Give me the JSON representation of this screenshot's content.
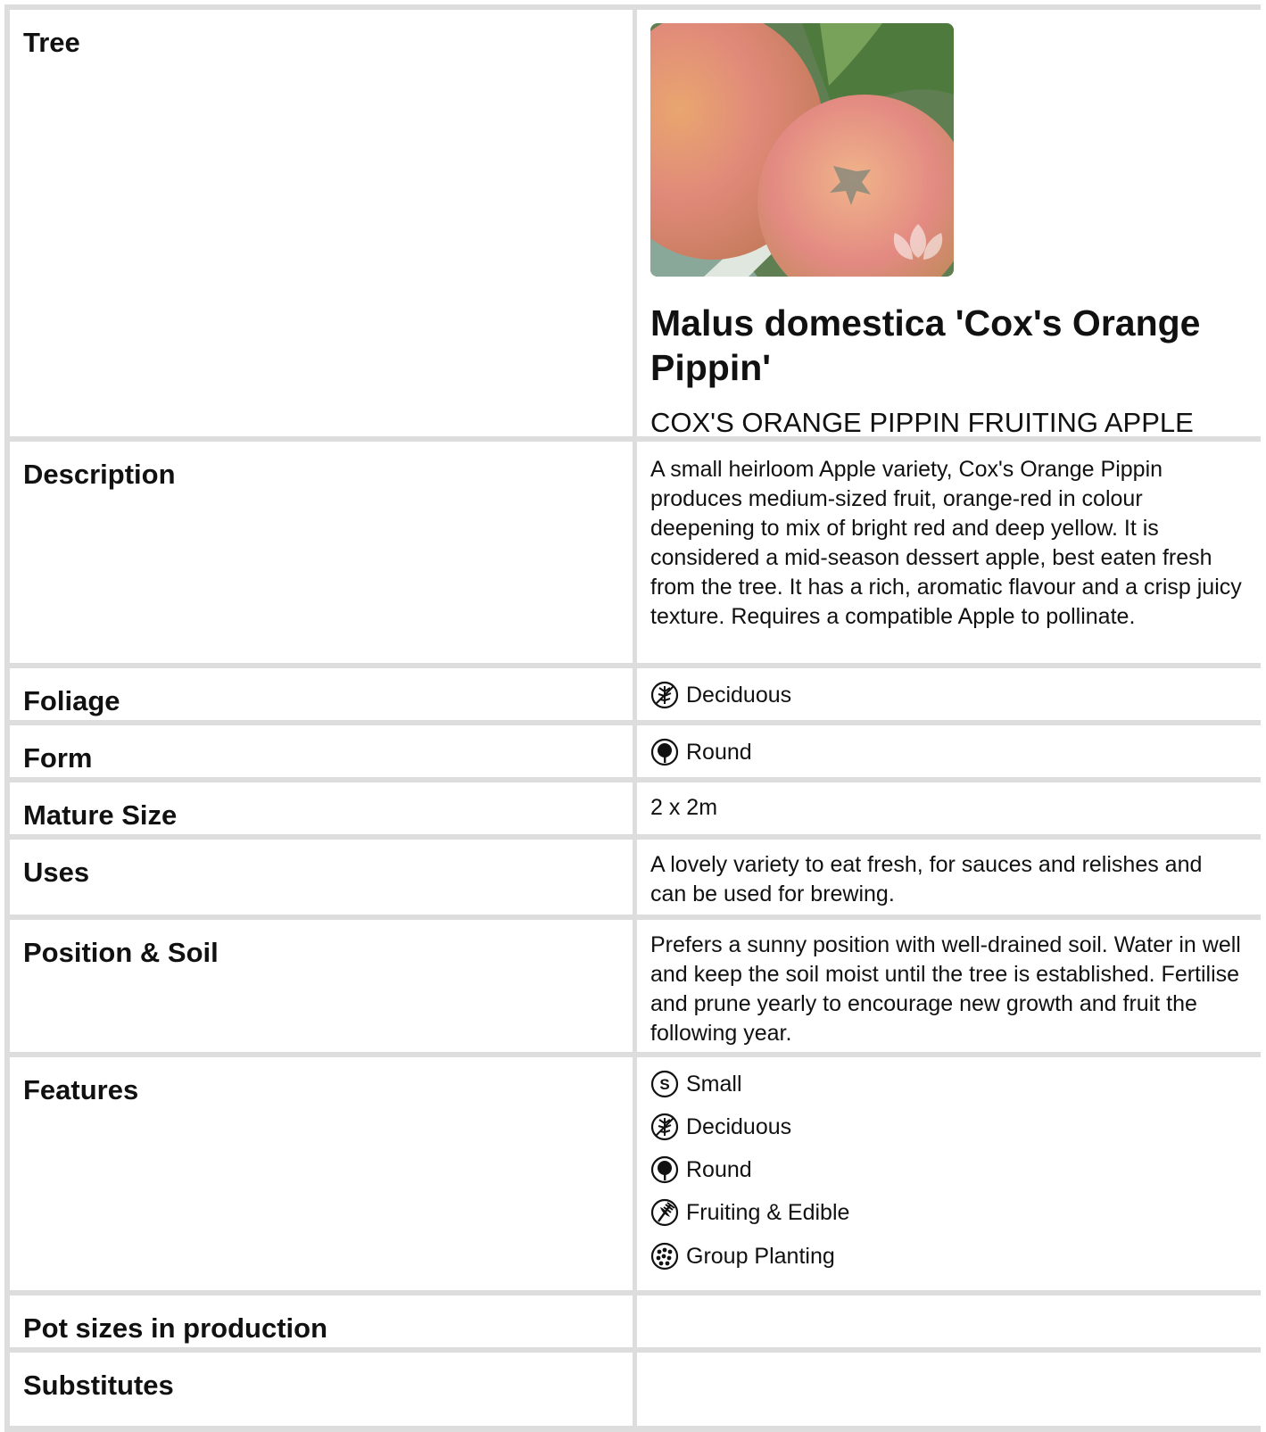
{
  "tree": {
    "label": "Tree",
    "title": "Malus domestica 'Cox's Orange Pippin'",
    "common_name": "COX'S ORANGE PIPPIN FRUITING APPLE"
  },
  "description": {
    "label": "Description",
    "text": "A small heirloom Apple variety, Cox's Orange Pippin produces medium-sized fruit, orange-red in colour deepening to mix of bright red and deep yellow. It is considered a mid-season dessert apple, best eaten fresh from the tree. It has a rich, aromatic flavour and a crisp juicy texture. Requires a compatible Apple to pollinate."
  },
  "foliage": {
    "label": "Foliage",
    "value": "Deciduous",
    "icon": "deciduous-icon"
  },
  "form": {
    "label": "Form",
    "value": "Round",
    "icon": "round-tree-icon"
  },
  "mature_size": {
    "label": "Mature Size",
    "value": "2 x 2m"
  },
  "uses": {
    "label": "Uses",
    "text": "A lovely variety to eat fresh, for sauces and relishes and can be used for brewing."
  },
  "position_soil": {
    "label": "Position & Soil",
    "text": "Prefers a sunny position with well-drained soil. Water in well and keep the soil moist until the tree is established. Fertilise and prune yearly to encourage new growth and fruit the following year."
  },
  "features": {
    "label": "Features",
    "items": [
      {
        "label": "Small",
        "icon": "small-size-icon"
      },
      {
        "label": "Deciduous",
        "icon": "deciduous-icon"
      },
      {
        "label": "Round",
        "icon": "round-tree-icon"
      },
      {
        "label": "Fruiting & Edible",
        "icon": "fruiting-edible-icon"
      },
      {
        "label": "Group Planting",
        "icon": "group-planting-icon"
      }
    ]
  },
  "pot_sizes": {
    "label": "Pot sizes in production",
    "value": ""
  },
  "substitutes": {
    "label": "Substitutes",
    "value": ""
  }
}
